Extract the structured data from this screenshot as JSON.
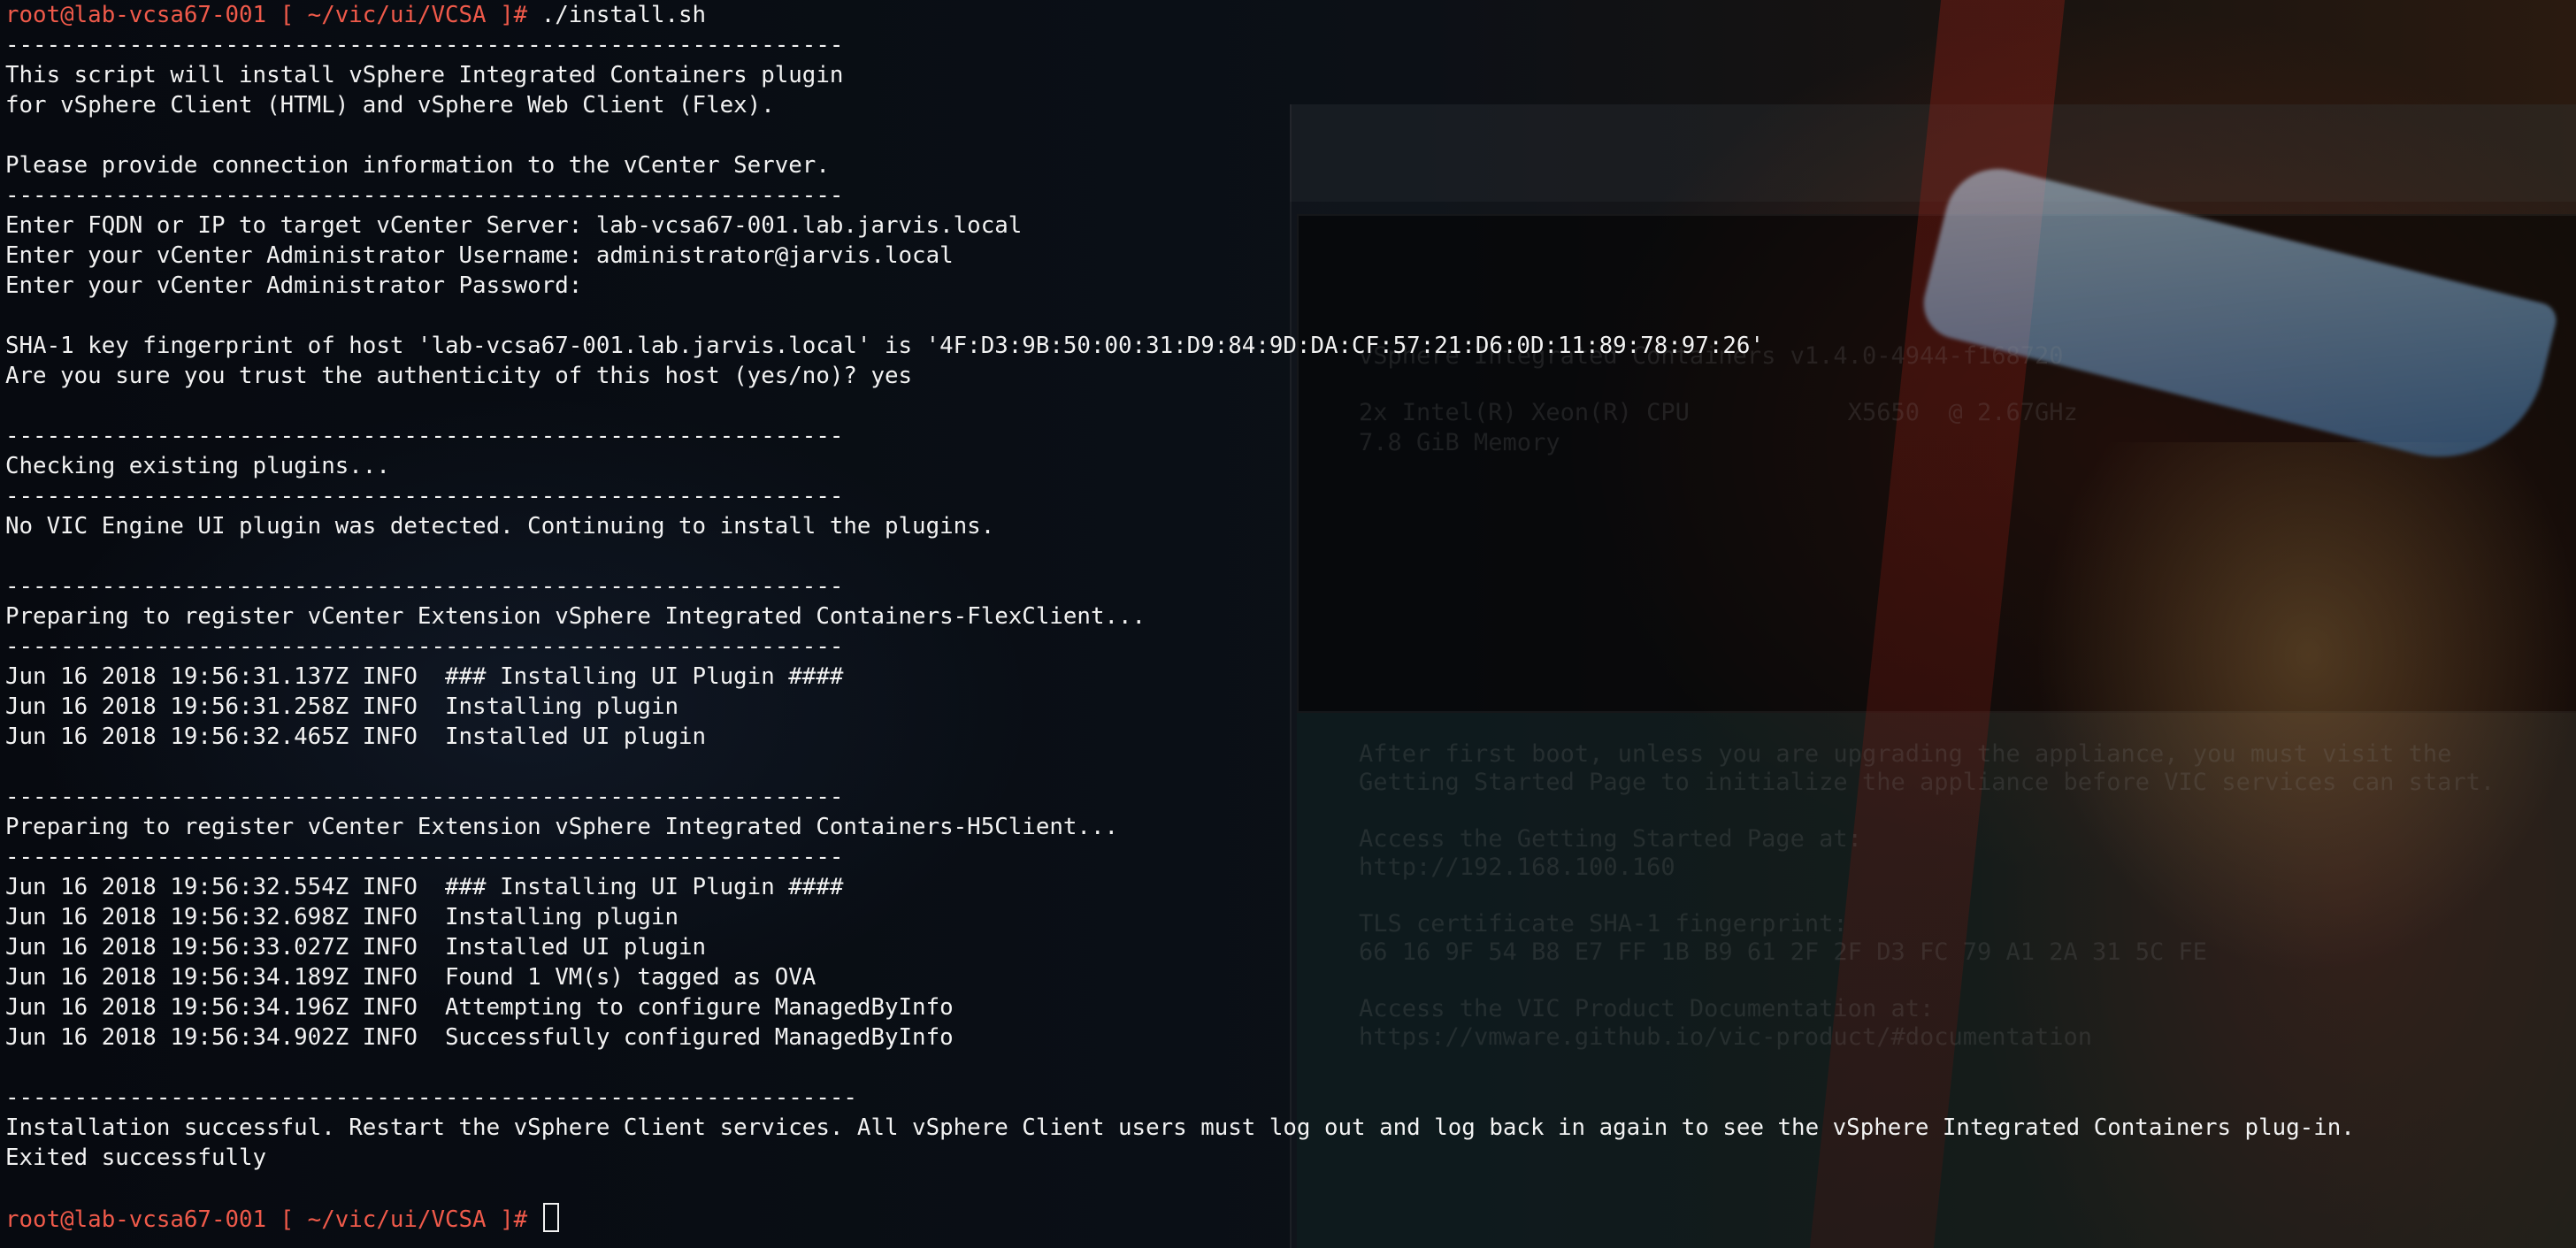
{
  "terminal": {
    "lines": [
      {
        "type": "prompt",
        "user_host": "root@lab-vcsa67-001",
        "path": " [ ~/vic/ui/VCSA ]# ",
        "command": "./install.sh"
      },
      {
        "type": "text",
        "text": "-------------------------------------------------------------"
      },
      {
        "type": "text",
        "text": "This script will install vSphere Integrated Containers plugin"
      },
      {
        "type": "text",
        "text": "for vSphere Client (HTML) and vSphere Web Client (Flex)."
      },
      {
        "type": "text",
        "text": ""
      },
      {
        "type": "text",
        "text": "Please provide connection information to the vCenter Server."
      },
      {
        "type": "text",
        "text": "-------------------------------------------------------------"
      },
      {
        "type": "text",
        "text": "Enter FQDN or IP to target vCenter Server: lab-vcsa67-001.lab.jarvis.local"
      },
      {
        "type": "text",
        "text": "Enter your vCenter Administrator Username: administrator@jarvis.local"
      },
      {
        "type": "text",
        "text": "Enter your vCenter Administrator Password:"
      },
      {
        "type": "text",
        "text": ""
      },
      {
        "type": "text",
        "text": "SHA-1 key fingerprint of host 'lab-vcsa67-001.lab.jarvis.local' is '4F:D3:9B:50:00:31:D9:84:9D:DA:CF:57:21:D6:0D:11:89:78:97:26'"
      },
      {
        "type": "text",
        "text": "Are you sure you trust the authenticity of this host (yes/no)? yes"
      },
      {
        "type": "text",
        "text": ""
      },
      {
        "type": "text",
        "text": "-------------------------------------------------------------"
      },
      {
        "type": "text",
        "text": "Checking existing plugins..."
      },
      {
        "type": "text",
        "text": "-------------------------------------------------------------"
      },
      {
        "type": "text",
        "text": "No VIC Engine UI plugin was detected. Continuing to install the plugins."
      },
      {
        "type": "text",
        "text": ""
      },
      {
        "type": "text",
        "text": "-------------------------------------------------------------"
      },
      {
        "type": "text",
        "text": "Preparing to register vCenter Extension vSphere Integrated Containers-FlexClient..."
      },
      {
        "type": "text",
        "text": "-------------------------------------------------------------"
      },
      {
        "type": "text",
        "text": "Jun 16 2018 19:56:31.137Z INFO  ### Installing UI Plugin ####"
      },
      {
        "type": "text",
        "text": "Jun 16 2018 19:56:31.258Z INFO  Installing plugin"
      },
      {
        "type": "text",
        "text": "Jun 16 2018 19:56:32.465Z INFO  Installed UI plugin"
      },
      {
        "type": "text",
        "text": ""
      },
      {
        "type": "text",
        "text": "-------------------------------------------------------------"
      },
      {
        "type": "text",
        "text": "Preparing to register vCenter Extension vSphere Integrated Containers-H5Client..."
      },
      {
        "type": "text",
        "text": "-------------------------------------------------------------"
      },
      {
        "type": "text",
        "text": "Jun 16 2018 19:56:32.554Z INFO  ### Installing UI Plugin ####"
      },
      {
        "type": "text",
        "text": "Jun 16 2018 19:56:32.698Z INFO  Installing plugin"
      },
      {
        "type": "text",
        "text": "Jun 16 2018 19:56:33.027Z INFO  Installed UI plugin"
      },
      {
        "type": "text",
        "text": "Jun 16 2018 19:56:34.189Z INFO  Found 1 VM(s) tagged as OVA"
      },
      {
        "type": "text",
        "text": "Jun 16 2018 19:56:34.196Z INFO  Attempting to configure ManagedByInfo"
      },
      {
        "type": "text",
        "text": "Jun 16 2018 19:56:34.902Z INFO  Successfully configured ManagedByInfo"
      },
      {
        "type": "text",
        "text": ""
      },
      {
        "type": "text",
        "text": "--------------------------------------------------------------"
      },
      {
        "type": "text",
        "text": "Installation successful. Restart the vSphere Client services. All vSphere Client users must log out and log back in again to see the vSphere Integrated Containers plug-in."
      },
      {
        "type": "text",
        "text": "Exited successfully"
      },
      {
        "type": "text",
        "text": ""
      },
      {
        "type": "prompt",
        "user_host": "root@lab-vcsa67-001",
        "path": " [ ~/vic/ui/VCSA ]# ",
        "command": ""
      }
    ]
  },
  "wallpaper": {
    "ghost_lines": [
      "vSphere Integrated Containers v1.4.0-4944-f168720",
      "2x Intel(R) Xeon(R) CPU           X5650  @ 2.67GHz",
      "7.8 GiB Memory",
      "After first boot, unless you are upgrading the appliance, you must visit the",
      "Getting Started Page to initialize the appliance before VIC services can start.",
      "Access the Getting Started Page at:",
      "http://192.168.100.160",
      "TLS certificate SHA-1 fingerprint:",
      "66 16 9F 54 B8 E7 FF 1B B9 61 2F 2F D3 FC 79 A1 2A 31 5C FE",
      "Access the VIC Product Documentation at:",
      "https://vmware.github.io/vic-product/#documentation"
    ]
  },
  "colors": {
    "prompt_user": "#f05a4a",
    "text": "#f2f2f2",
    "background": "#05080c"
  }
}
